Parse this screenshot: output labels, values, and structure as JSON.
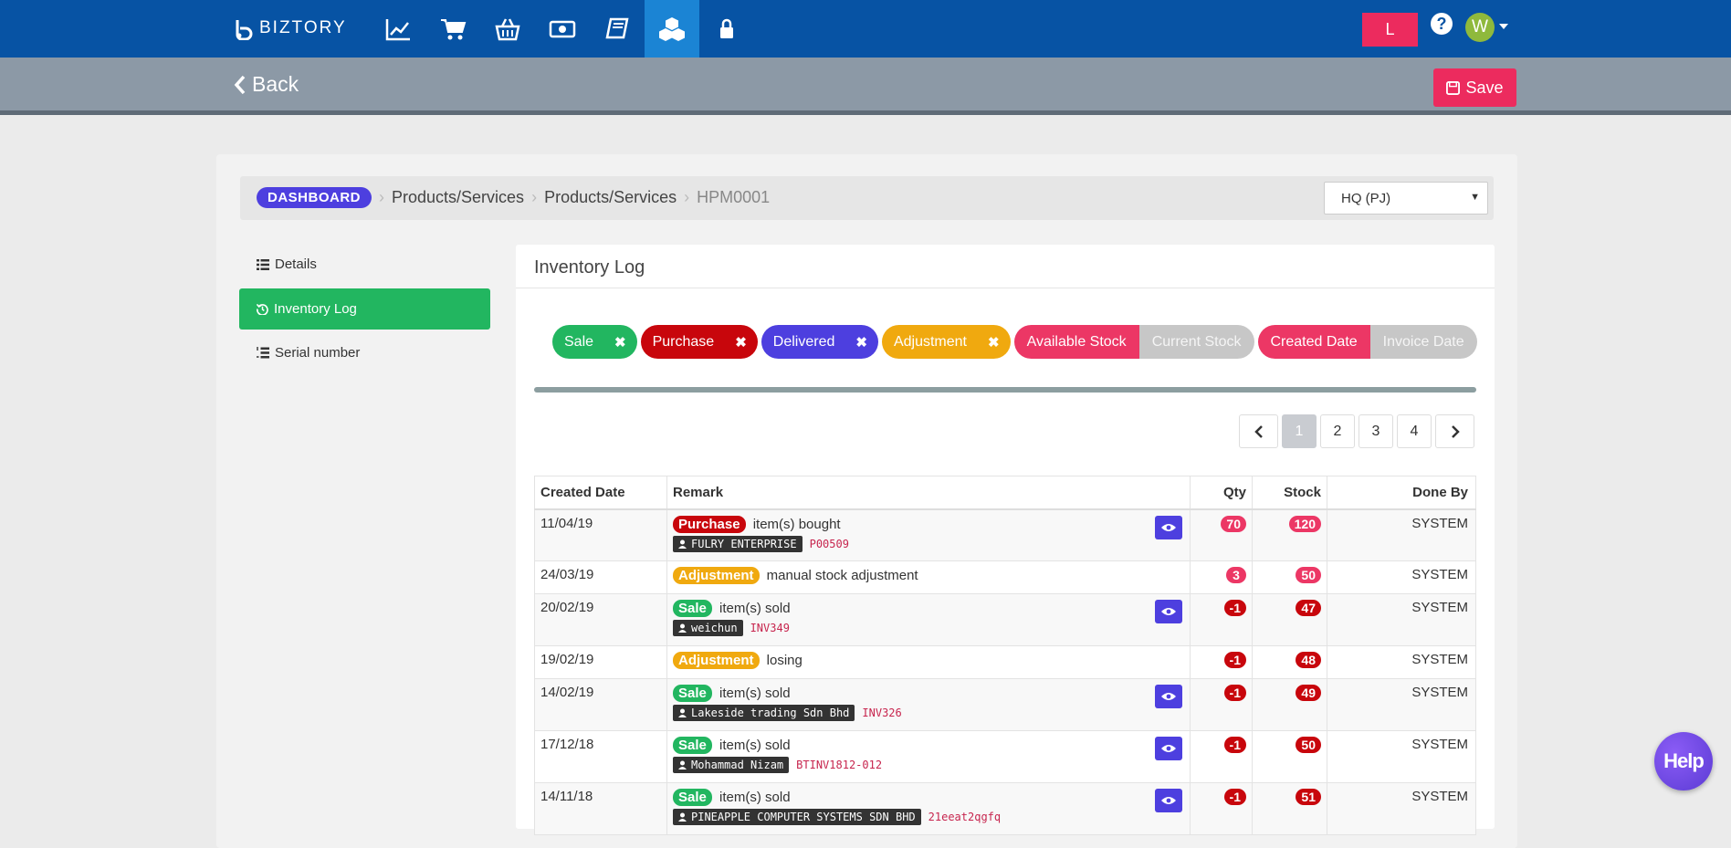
{
  "brand": {
    "name": "BIZTORY"
  },
  "nav": {
    "icons": [
      "chart-line-icon",
      "cart-icon",
      "basket-icon",
      "money-icon",
      "book-icon",
      "cubes-icon",
      "lock-icon"
    ],
    "active": "cubes-icon"
  },
  "user": {
    "branch_button": "L",
    "help_q": "?",
    "avatar_initial": "W"
  },
  "subbar": {
    "back_label": "Back",
    "save_label": "Save"
  },
  "breadcrumb": {
    "dashboard": "DASHBOARD",
    "crumb1": "Products/Services",
    "crumb2": "Products/Services",
    "current": "HPM0001"
  },
  "branch_select": {
    "value": "HQ (PJ)"
  },
  "sidebar": {
    "details": "Details",
    "inventory_log": "Inventory Log",
    "serial_number": "Serial number"
  },
  "panel": {
    "title": "Inventory Log"
  },
  "filters": {
    "sale": "Sale",
    "purchase": "Purchase",
    "delivered": "Delivered",
    "adjustment": "Adjustment",
    "available_stock": "Available Stock",
    "current_stock": "Current Stock",
    "created_date": "Created Date",
    "invoice_date": "Invoice Date",
    "remove_symbol": "✖"
  },
  "pagination": {
    "p1": "1",
    "p2": "2",
    "p3": "3",
    "p4": "4",
    "current": "1"
  },
  "table": {
    "headers": {
      "created_date": "Created Date",
      "remark": "Remark",
      "qty": "Qty",
      "stock": "Stock",
      "done_by": "Done By"
    },
    "rows": [
      {
        "date": "11/04/19",
        "type": "Purchase",
        "text": "item(s) bought",
        "party": "FULRY ENTERPRISE",
        "ref": "P00509",
        "qty": "70",
        "stock": "120",
        "done_by": "SYSTEM"
      },
      {
        "date": "24/03/19",
        "type": "Adjustment",
        "text": "manual stock adjustment",
        "party": "",
        "ref": "",
        "qty": "3",
        "stock": "50",
        "done_by": "SYSTEM"
      },
      {
        "date": "20/02/19",
        "type": "Sale",
        "text": "item(s) sold",
        "party": "weichun",
        "ref": "INV349",
        "qty": "-1",
        "stock": "47",
        "done_by": "SYSTEM"
      },
      {
        "date": "19/02/19",
        "type": "Adjustment",
        "text": "losing",
        "party": "",
        "ref": "",
        "qty": "-1",
        "stock": "48",
        "done_by": "SYSTEM"
      },
      {
        "date": "14/02/19",
        "type": "Sale",
        "text": "item(s) sold",
        "party": "Lakeside trading Sdn Bhd",
        "ref": "INV326",
        "qty": "-1",
        "stock": "49",
        "done_by": "SYSTEM"
      },
      {
        "date": "17/12/18",
        "type": "Sale",
        "text": "item(s) sold",
        "party": "Mohammad Nizam",
        "ref": "BTINV1812-012",
        "qty": "-1",
        "stock": "50",
        "done_by": "SYSTEM"
      },
      {
        "date": "14/11/18",
        "type": "Sale",
        "text": "item(s) sold",
        "party": "PINEAPPLE COMPUTER SYSTEMS SDN BHD",
        "ref": "21eeat2qgfq",
        "qty": "-1",
        "stock": "51",
        "done_by": "SYSTEM"
      }
    ]
  },
  "help_bubble": {
    "label": "Help"
  },
  "colors": {
    "nav_bg": "#0753a4",
    "accent_pink": "#ec2b5e",
    "sale": "#22b660",
    "purchase": "#c8060c",
    "delivered": "#4d3fdf",
    "adjustment": "#f0a90f"
  }
}
